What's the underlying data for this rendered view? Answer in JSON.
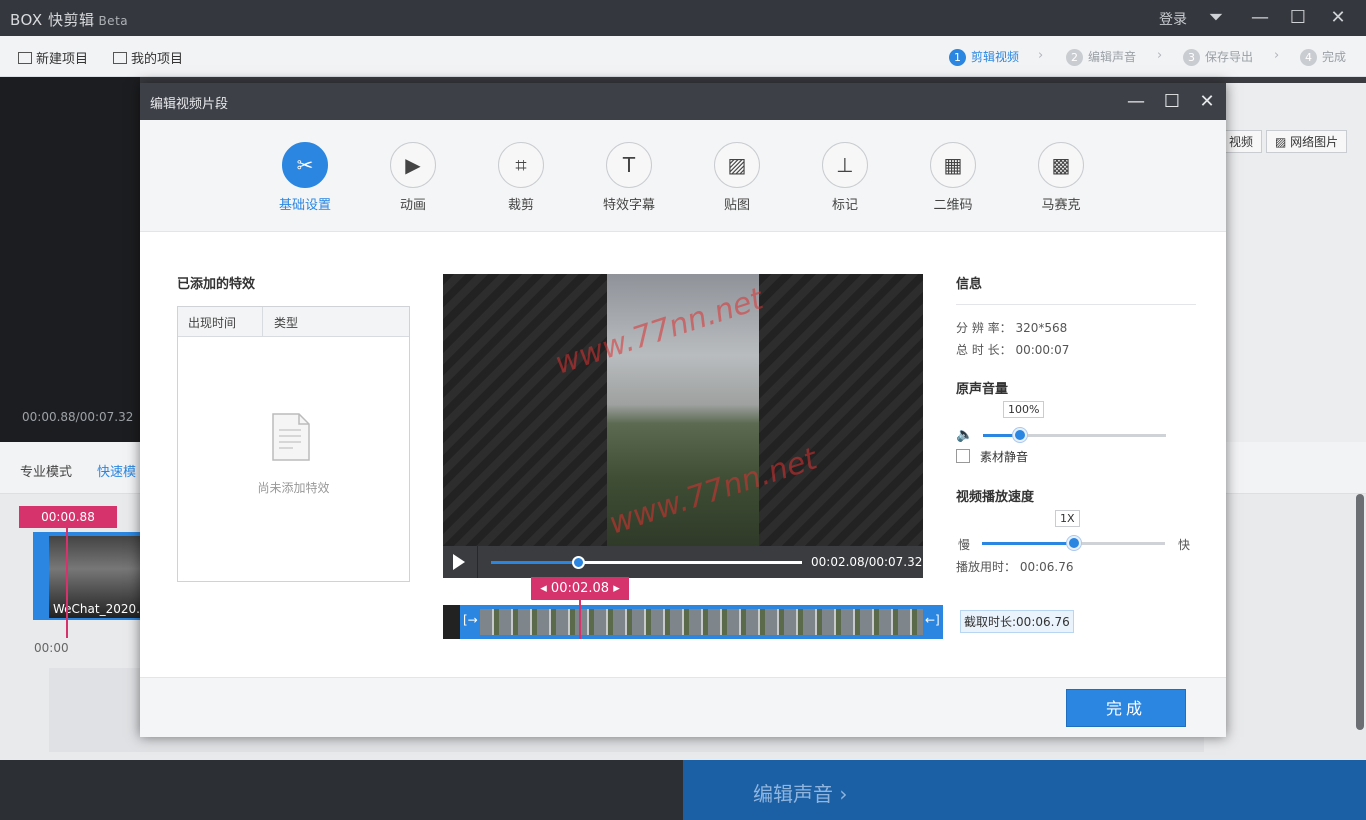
{
  "app": {
    "logo": "BOX",
    "name": "快剪辑",
    "beta": "Beta",
    "login": "登录"
  },
  "toolbar": {
    "new_project": "新建项目",
    "my_projects": "我的项目"
  },
  "steps": [
    {
      "num": "1",
      "label": "剪辑视频"
    },
    {
      "num": "2",
      "label": "编辑声音"
    },
    {
      "num": "3",
      "label": "保存导出"
    },
    {
      "num": "4",
      "label": "完成"
    }
  ],
  "background": {
    "preview_time": "00:00.88/00:07.32",
    "btn_video": "视频",
    "btn_web_image": "网络图片",
    "mode_pro": "专业模式",
    "mode_fast": "快速模",
    "marker_time": "00:00.88",
    "clip_label": "WeChat_2020...",
    "zero": "00:00",
    "bottom_next": "编辑声音 ›"
  },
  "dialog": {
    "title": "编辑视频片段",
    "tabs": [
      {
        "label": "基础设置",
        "icon": "scissors-icon",
        "glyph": "✂"
      },
      {
        "label": "动画",
        "icon": "animation-icon",
        "glyph": "▶"
      },
      {
        "label": "裁剪",
        "icon": "crop-icon",
        "glyph": "⌗"
      },
      {
        "label": "特效字幕",
        "icon": "text-icon",
        "glyph": "T"
      },
      {
        "label": "贴图",
        "icon": "image-icon",
        "glyph": "▨"
      },
      {
        "label": "标记",
        "icon": "pin-icon",
        "glyph": "⊥"
      },
      {
        "label": "二维码",
        "icon": "qrcode-icon",
        "glyph": "▦"
      },
      {
        "label": "马赛克",
        "icon": "mosaic-icon",
        "glyph": "▩"
      }
    ],
    "effects": {
      "title": "已添加的特效",
      "col_time": "出现时间",
      "col_type": "类型",
      "empty": "尚未添加特效"
    },
    "player": {
      "time": "00:02.08/00:07.32",
      "progress": 0.284,
      "watermark": "www.77nn.net"
    },
    "strip": {
      "marker": "00:02.08",
      "cut_length": "截取时长:00:06.76"
    },
    "info": {
      "title": "信息",
      "resolution_label": "分 辨 率：",
      "resolution": "320*568",
      "duration_label": "总 时 长：",
      "duration": "00:00:07"
    },
    "volume": {
      "title": "原声音量",
      "value": "100%",
      "level": 0.2,
      "mute_label": "素材静音"
    },
    "speed": {
      "title": "视频播放速度",
      "value": "1X",
      "level": 0.5,
      "slow": "慢",
      "fast": "快",
      "play_time_label": "播放用时：",
      "play_time": "00:06.76"
    },
    "done": "完成"
  }
}
